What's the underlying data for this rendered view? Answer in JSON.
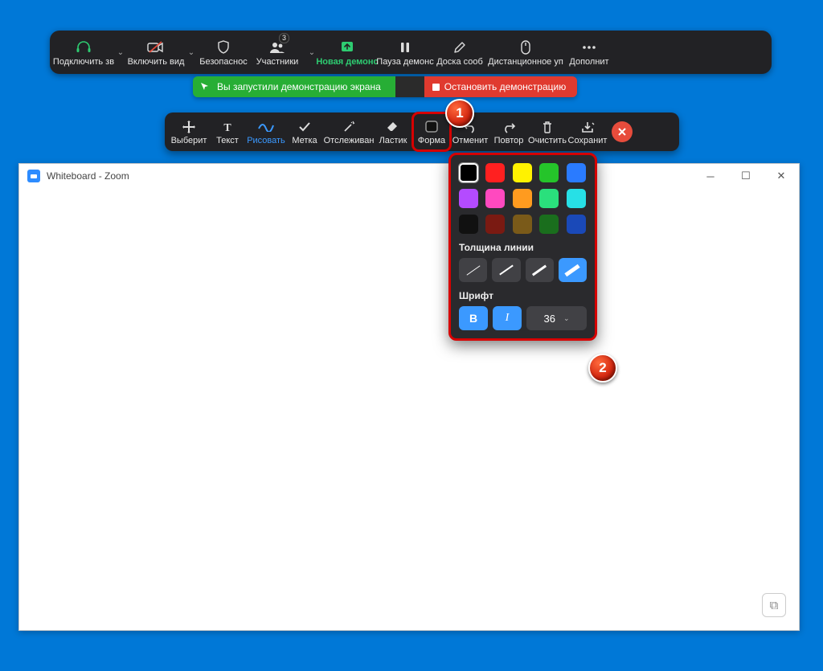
{
  "meeting_toolbar": {
    "audio": "Подключить зв",
    "video": "Включить вид",
    "security": "Безопаснос",
    "participants": "Участники",
    "participants_badge": "3",
    "new_share": "Новая демонс",
    "pause_share": "Пауза демонс",
    "whiteboard": "Доска сооб",
    "remote": "Дистанционное уп",
    "more": "Дополнит"
  },
  "status": {
    "sharing": "Вы запустили демонстрацию экрана",
    "stop": "Остановить демонстрацию"
  },
  "annot_toolbar": {
    "select": "Выберит",
    "text": "Текст",
    "draw": "Рисовать",
    "stamp": "Метка",
    "spotlight": "Отслеживан",
    "eraser": "Ластик",
    "format": "Форма",
    "undo": "Отменит",
    "redo": "Повтор",
    "clear": "Очистить",
    "save": "Сохранит"
  },
  "popup": {
    "colors": [
      "#000000",
      "#ff2020",
      "#fff200",
      "#25c42a",
      "#2a7bff",
      "#b44bff",
      "#ff49bf",
      "#ff9b1f",
      "#2ae07c",
      "#27e0e6",
      "#111111",
      "#7a1a12",
      "#7a5a19",
      "#1a6e1d",
      "#1a49b8"
    ],
    "selected_color_index": 0,
    "thickness_label": "Толщина линии",
    "thickness_values": [
      1,
      2,
      3,
      5
    ],
    "thickness_selected": 3,
    "font_label": "Шрифт",
    "bold": "B",
    "italic": "I",
    "font_size": "36"
  },
  "callouts": {
    "one": "1",
    "two": "2"
  },
  "whiteboard_window": {
    "title": "Whiteboard - Zoom"
  }
}
